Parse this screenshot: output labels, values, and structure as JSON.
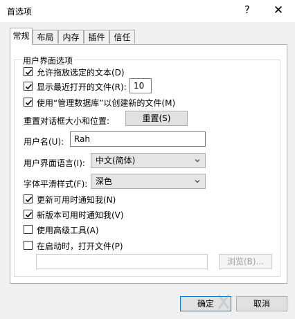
{
  "window": {
    "title": "首选项",
    "help_glyph": "?",
    "close_glyph": "✕"
  },
  "tabs": [
    {
      "label": "常规",
      "active": true
    },
    {
      "label": "布局",
      "active": false
    },
    {
      "label": "内存",
      "active": false
    },
    {
      "label": "插件",
      "active": false
    },
    {
      "label": "信任",
      "active": false
    }
  ],
  "group": {
    "label": "用户界面选项"
  },
  "options": {
    "drag_drop": {
      "label": "允许拖放选定的文本(D)",
      "checked": true
    },
    "recent_files": {
      "label": "显示最近打开的文件(R):",
      "checked": true,
      "count": "10"
    },
    "manage_db": {
      "label": "使用“管理数据库”以创建新的文件(M)",
      "checked": true
    }
  },
  "reset": {
    "label": "重置对话框大小和位置:",
    "button": "重置(S)"
  },
  "username": {
    "label": "用户名(U):",
    "value": "Rah"
  },
  "language": {
    "label": "用户界面语言(I):",
    "value": "中文(简体)"
  },
  "font_smoothing": {
    "label": "字体平滑样式(F):",
    "value": "深色"
  },
  "notify": {
    "updates": {
      "label": "更新可用时通知我(N)",
      "checked": true
    },
    "new_version": {
      "label": "新版本可用时通知我(V)",
      "checked": true
    },
    "advanced": {
      "label": "使用高级工具(A)",
      "checked": false
    },
    "startup": {
      "label": "在启动时，打开文件(P)",
      "checked": false
    }
  },
  "startup_file": {
    "value": "",
    "browse": "浏览(B)..."
  },
  "footer": {
    "ok": "确定",
    "cancel": "取消"
  },
  "colors": {
    "accent": "#0078d7",
    "checkmark": "#000000"
  }
}
